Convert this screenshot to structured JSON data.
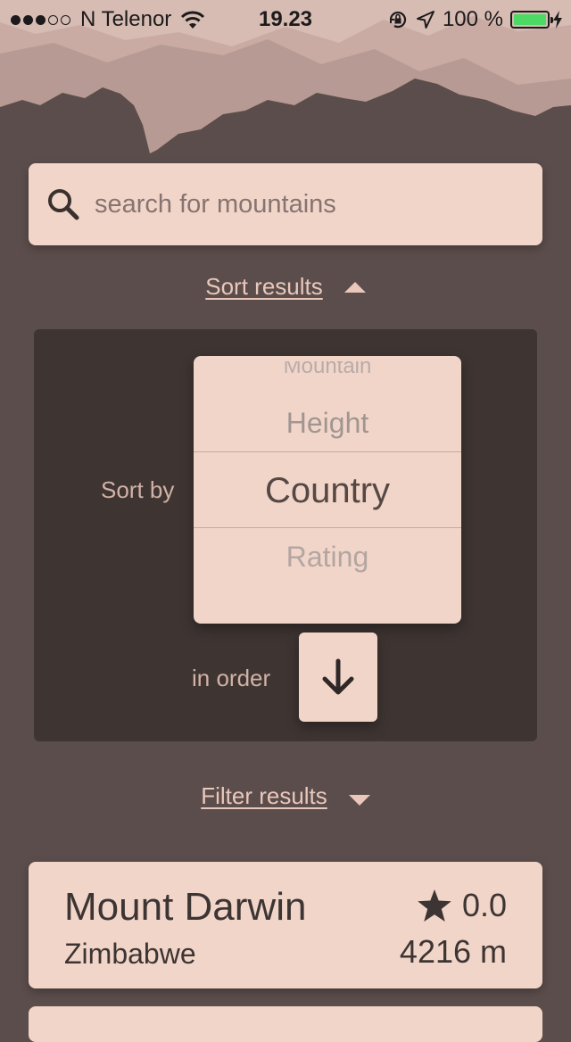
{
  "status_bar": {
    "signal_bars_filled": 3,
    "signal_bars_total": 5,
    "carrier": "N Telenor",
    "time": "19.23",
    "battery": "100 %",
    "icons": [
      "wifi-icon",
      "rotation-lock-icon",
      "location-arrow-icon",
      "battery-icon",
      "charging-bolt-icon"
    ]
  },
  "search": {
    "placeholder": "search for mountains",
    "value": "",
    "icon": "search-icon"
  },
  "sort": {
    "toggle_label": "Sort results",
    "expanded": true,
    "sort_by_label": "Sort by",
    "options": [
      "Mountain",
      "Height",
      "Country",
      "Rating"
    ],
    "selected": "Country",
    "order_label": "in order",
    "order_direction": "descending",
    "order_icon": "arrow-down-icon"
  },
  "filter": {
    "toggle_label": "Filter results",
    "expanded": false
  },
  "results": [
    {
      "name": "Mount Darwin",
      "country": "Zimbabwe",
      "rating": "0.0",
      "height": "4216 m"
    }
  ],
  "colors": {
    "background": "#5b4d4b",
    "card": "#f2d5c9",
    "panel": "#3e3532",
    "link": "#e9c8bb",
    "battery": "#4cd964"
  }
}
